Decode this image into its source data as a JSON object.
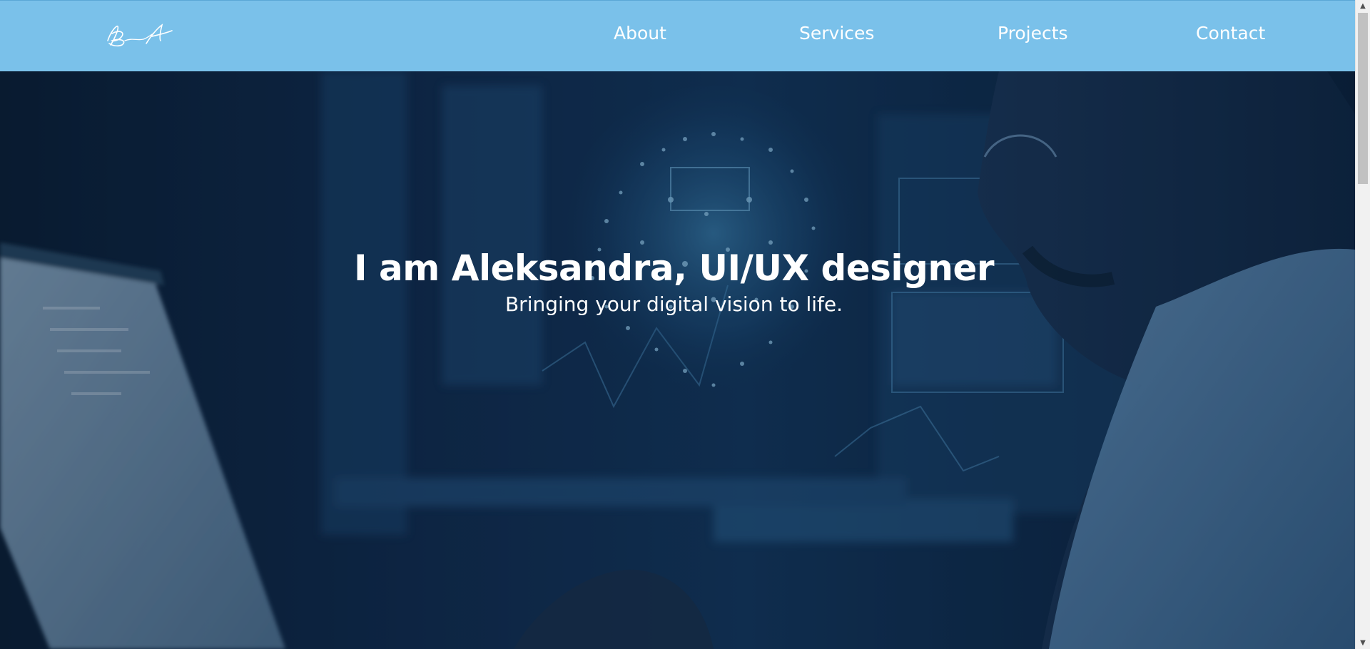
{
  "header": {
    "logo_alt": "BA",
    "nav": [
      {
        "label": "About"
      },
      {
        "label": "Services"
      },
      {
        "label": "Projects"
      },
      {
        "label": "Contact"
      }
    ],
    "background_color": "#7ac1ea"
  },
  "hero": {
    "title": "I am Aleksandra, UI/UX designer",
    "subtitle": "Bringing your digital vision to life.",
    "background_description_icon": "ai-head-person-laptop-image"
  },
  "colors": {
    "header": "#7ac1ea",
    "text": "#ffffff",
    "hero_base": "#10294a"
  }
}
